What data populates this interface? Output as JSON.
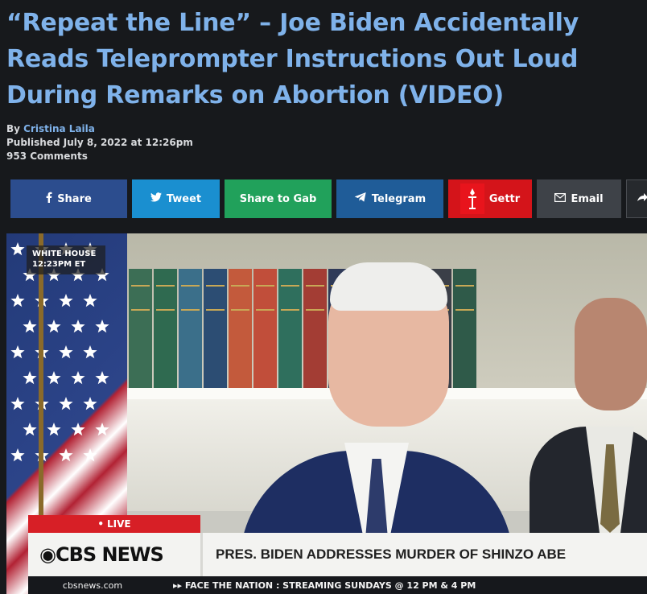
{
  "article": {
    "headline": "“Repeat the Line” – Joe Biden Accidentally Reads Teleprompter Instructions Out Loud During Remarks on Abortion (VIDEO)",
    "byline_prefix": "By",
    "author": "Cristina Laila",
    "published": "Published July 8, 2022 at 12:26pm",
    "comments": "953 Comments"
  },
  "share": {
    "facebook": "Share",
    "twitter": "Tweet",
    "gab": "Share to Gab",
    "telegram": "Telegram",
    "gettr": "Gettr",
    "email": "Email"
  },
  "video": {
    "location_tag_line1": "WHITE HOUSE",
    "location_tag_line2": "12:23PM  ET",
    "live_label": "LIVE",
    "network_logo": "CBS NEWS",
    "chyron": "PRES. BIDEN ADDRESSES MURDER OF SHINZO ABE",
    "ticker_site": "cbsnews.com",
    "ticker_crawl": "FACE THE NATION : STREAMING SUNDAYS @ 12 PM & 4 PM"
  },
  "colors": {
    "background": "#17191c",
    "headline": "#7fb2ea",
    "facebook": "#2c4d8e",
    "twitter": "#1a8fd0",
    "gab": "#21a15b",
    "telegram": "#1f5c98",
    "gettr": "#d4141a",
    "email": "#3e4248"
  },
  "book_colors": [
    "#5a3a2e",
    "#2e4f7a",
    "#3c6e55",
    "#2f6a50",
    "#3b6f8a",
    "#2c4d73",
    "#c35a3c",
    "#c14e3a",
    "#2f6f5d",
    "#a33d34",
    "#2f3a58",
    "#2c4d73",
    "#3b3f48",
    "#8b3e35",
    "#3b3f48",
    "#2f5a49"
  ]
}
